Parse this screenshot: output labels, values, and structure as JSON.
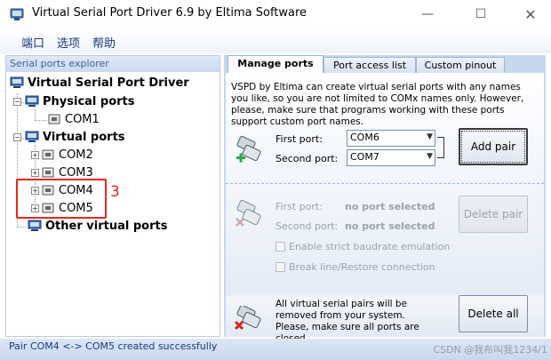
{
  "window": {
    "title": "Virtual Serial Port Driver 6.9 by Eltima Software",
    "min_glyph": "—",
    "max_glyph": "☐",
    "close_glyph": "✕"
  },
  "menu": [
    "端口",
    "选项",
    "帮助"
  ],
  "explorer": {
    "header": "Serial ports explorer",
    "root": "Virtual Serial Port Driver",
    "physical": {
      "label": "Physical ports",
      "ports": [
        "COM1"
      ]
    },
    "virtual": {
      "label": "Virtual ports",
      "ports": [
        "COM2",
        "COM3",
        "COM4",
        "COM5"
      ]
    },
    "other": {
      "label": "Other virtual ports"
    }
  },
  "annotation": {
    "number": "3",
    "color": "#e8261c"
  },
  "tabs": [
    "Manage ports",
    "Port access list",
    "Custom pinout"
  ],
  "manage": {
    "description": "VSPD by Eltima can create virtual serial ports with any names you like, so you are not limited to COMx names only. However, please, make sure that programs working with these ports support custom port names.",
    "first_port_label": "First port:",
    "first_port_value": "COM6",
    "second_port_label": "Second port:",
    "second_port_value": "COM7",
    "add_pair": "Add pair",
    "del_first_label": "First port:",
    "del_first_value": "no port selected",
    "del_second_label": "Second port:",
    "del_second_value": "no port selected",
    "delete_pair": "Delete pair",
    "strict_baud": "Enable strict baudrate emulation",
    "break_line": "Break line/Restore connection",
    "delete_all_text": "All virtual serial pairs will be removed from your system. Please, make sure all ports are closed.",
    "delete_all": "Delete all"
  },
  "status": {
    "text": "Pair COM4 <-> COM5 created successfully",
    "watermark": "CSDN @我布叫我1234/1"
  },
  "icons": {
    "app": "serial-port-app-icon",
    "computer": "computer-icon",
    "port": "serial-port-icon",
    "add": "add-pair-icon",
    "delete": "delete-pair-icon",
    "delete_all": "delete-all-icon"
  },
  "colors": {
    "accent": "#1a3a7a",
    "panel_bg": "#c6d7ee",
    "annotation": "#e8261c"
  }
}
